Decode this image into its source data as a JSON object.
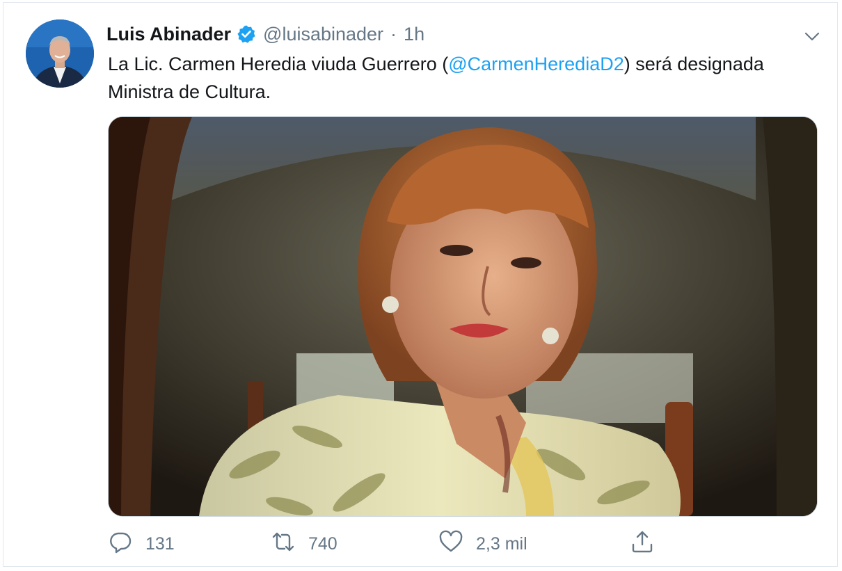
{
  "tweet": {
    "author": {
      "name": "Luis Abinader",
      "handle": "@luisabinader",
      "verified": true
    },
    "separator": "·",
    "time": "1h",
    "text_before": "La Lic. Carmen Heredia viuda Guerrero (",
    "mention": "@CarmenHerediaD2",
    "text_after": ") será designada Ministra de Cultura.",
    "media": {
      "kind": "photo"
    },
    "actions": {
      "replies": "131",
      "retweets": "740",
      "likes": "2,3 mil"
    }
  },
  "icons": {
    "verified": "verified-badge-icon",
    "more": "chevron-down-icon",
    "reply": "reply-icon",
    "retweet": "retweet-icon",
    "like": "heart-icon",
    "share": "share-icon"
  },
  "colors": {
    "link": "#1da1f2",
    "secondary_text": "#657786",
    "primary_text": "#14171a",
    "border": "#e1e8ed"
  }
}
